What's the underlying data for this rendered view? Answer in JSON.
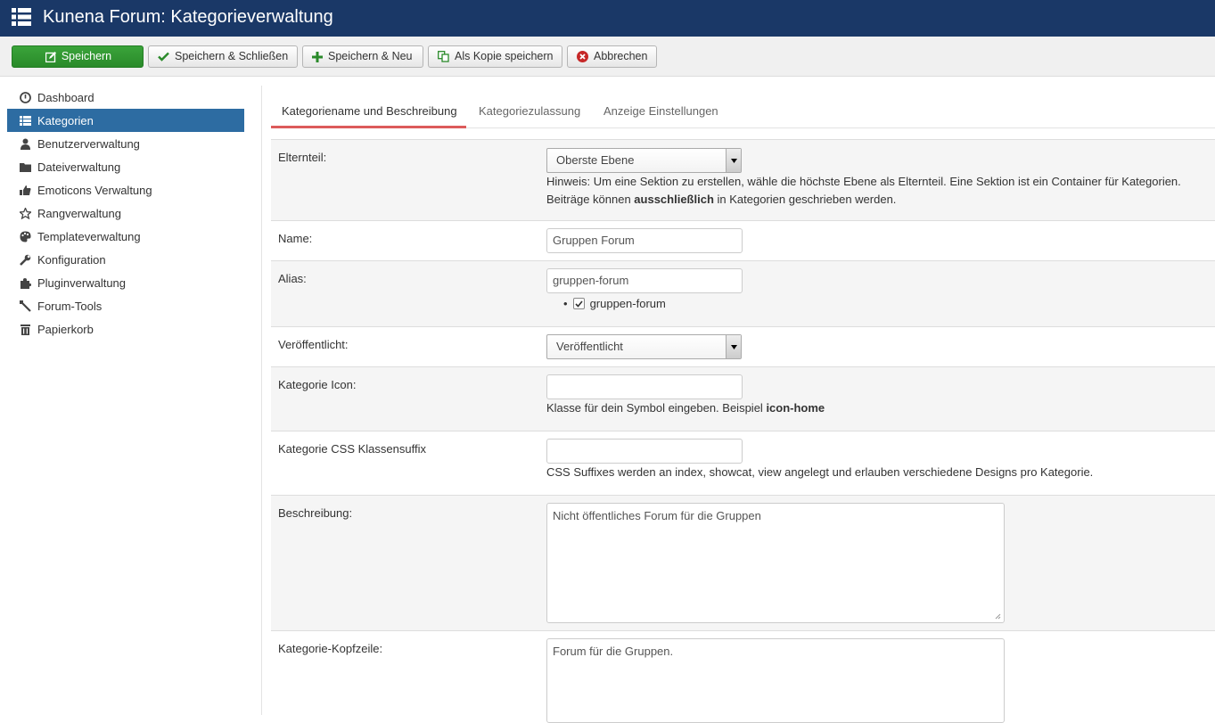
{
  "header": {
    "title": "Kunena Forum: Kategorieverwaltung",
    "menu_icon": "list-icon"
  },
  "toolbar": {
    "save": "Speichern",
    "save_close": "Speichern & Schließen",
    "save_new": "Speichern & Neu",
    "save_copy": "Als Kopie speichern",
    "cancel": "Abbrechen"
  },
  "sidebar": {
    "items": [
      {
        "label": "Dashboard",
        "icon": "dashboard-icon"
      },
      {
        "label": "Kategorien",
        "icon": "list-icon",
        "active": true
      },
      {
        "label": "Benutzerverwaltung",
        "icon": "user-icon"
      },
      {
        "label": "Dateiverwaltung",
        "icon": "folder-icon"
      },
      {
        "label": "Emoticons Verwaltung",
        "icon": "thumbs-up-icon"
      },
      {
        "label": "Rangverwaltung",
        "icon": "star-icon"
      },
      {
        "label": "Templateverwaltung",
        "icon": "palette-icon"
      },
      {
        "label": "Konfiguration",
        "icon": "wrench-icon"
      },
      {
        "label": "Pluginverwaltung",
        "icon": "puzzle-icon"
      },
      {
        "label": "Forum-Tools",
        "icon": "tool-icon"
      },
      {
        "label": "Papierkorb",
        "icon": "trash-icon"
      }
    ]
  },
  "tabs": [
    {
      "label": "Kategoriename und Beschreibung",
      "active": true
    },
    {
      "label": "Kategoriezulassung"
    },
    {
      "label": "Anzeige Einstellungen"
    }
  ],
  "form": {
    "parent": {
      "label": "Elternteil:",
      "value": "Oberste Ebene",
      "hint_1": "Hinweis: Um eine Sektion zu erstellen, wähle die höchste Ebene als Elternteil. Eine Sektion ist ein Container für Kategorien.",
      "hint_2a": "Beiträge können ",
      "hint_2b": "ausschließlich",
      "hint_2c": " in Kategorien geschrieben werden."
    },
    "name": {
      "label": "Name:",
      "value": "Gruppen Forum"
    },
    "alias": {
      "label": "Alias:",
      "value": "gruppen-forum",
      "option": "gruppen-forum",
      "checked": true
    },
    "published": {
      "label": "Veröffentlicht:",
      "value": "Veröffentlicht"
    },
    "icon": {
      "label": "Kategorie Icon:",
      "value": "",
      "hint_a": "Klasse für dein Symbol eingeben. Beispiel ",
      "hint_b": "icon-home"
    },
    "css": {
      "label": "Kategorie CSS Klassensuffix",
      "value": "",
      "hint": "CSS Suffixes werden an index, showcat, view angelegt und erlauben verschiedene Designs pro Kategorie."
    },
    "description": {
      "label": "Beschreibung:",
      "value": "Nicht öffentliches Forum für die Gruppen"
    },
    "headerdesc": {
      "label": "Kategorie-Kopfzeile:",
      "value": "Forum für die Gruppen."
    }
  },
  "colors": {
    "header_bg": "#1a3867",
    "primary": "#2f962f",
    "active_sidebar": "#2d6ca2",
    "tab_underline": "#dc5b5b"
  }
}
